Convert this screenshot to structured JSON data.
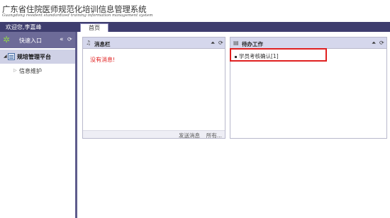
{
  "header": {
    "title": "广东省住院医师规范化培训信息管理系统",
    "subtitle": "Guangdong resident standardized training information management system"
  },
  "topbar": {
    "welcome": "欢迎您,李嘉峰",
    "tab_home": "首页"
  },
  "sidebar": {
    "title": "快速入口",
    "collapse_icon": "double-chevron-left-icon",
    "refresh_icon": "refresh-icon",
    "group_label": "规培管理平台",
    "items": [
      {
        "label": "信息维护"
      }
    ]
  },
  "panels": {
    "messages": {
      "title": "消息栏",
      "empty_text": "没有消息!",
      "send_label": "发送消息",
      "all_label": "所有..."
    },
    "tasks": {
      "title": "待办工作",
      "items": [
        {
          "label": "学员考核确认[1]"
        }
      ]
    }
  },
  "colors": {
    "topbar": "#3e3d6e",
    "sidebar_head": "#6d6b98",
    "panel_head": "#d5d7ec",
    "highlight": "#e02020",
    "empty_message": "#e02020"
  }
}
